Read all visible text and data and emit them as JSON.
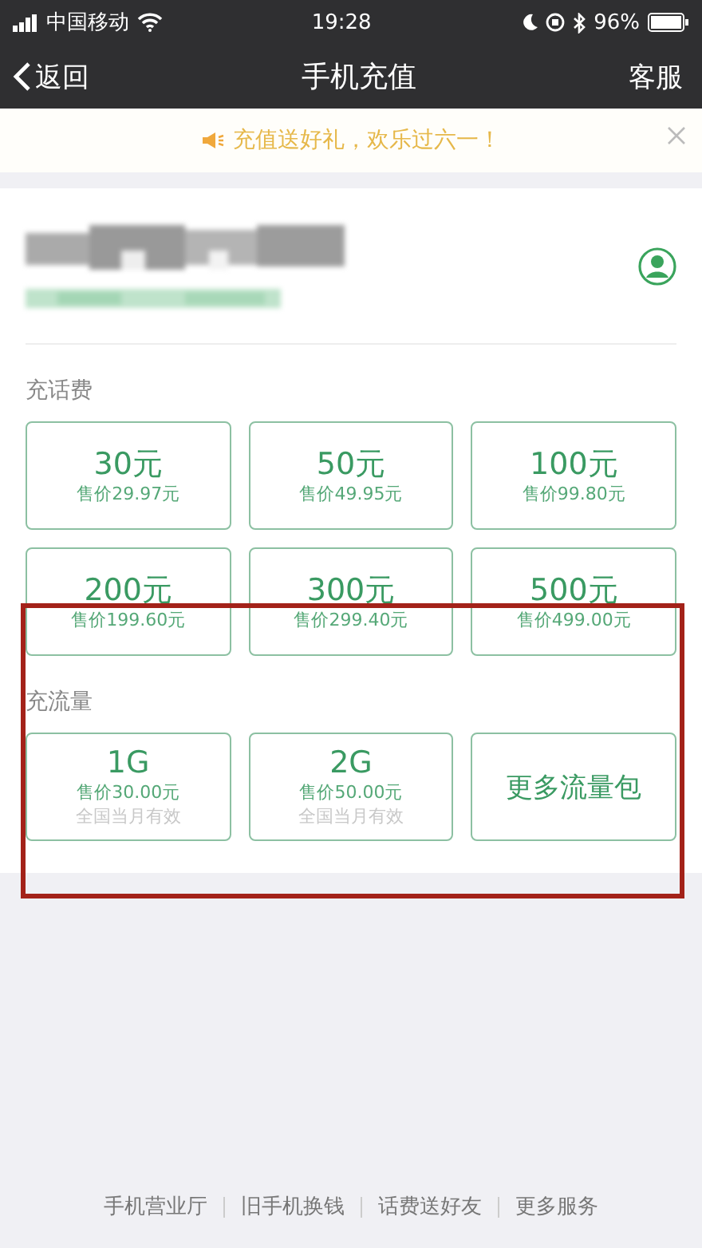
{
  "status_bar": {
    "carrier": "中国移动",
    "time": "19:28",
    "battery": "96%"
  },
  "nav": {
    "back": "返回",
    "title": "手机充值",
    "action": "客服"
  },
  "notice": {
    "text": "充值送好礼，欢乐过六一！"
  },
  "sections": [
    {
      "label": "充话费",
      "highlighted": false,
      "tiles": [
        {
          "kind": "price",
          "amount": "30元",
          "price": "售价29.97元"
        },
        {
          "kind": "price",
          "amount": "50元",
          "price": "售价49.95元"
        },
        {
          "kind": "price",
          "amount": "100元",
          "price": "售价99.80元"
        },
        {
          "kind": "price",
          "amount": "200元",
          "price": "售价199.60元"
        },
        {
          "kind": "price",
          "amount": "300元",
          "price": "售价299.40元"
        },
        {
          "kind": "price",
          "amount": "500元",
          "price": "售价499.00元"
        }
      ]
    },
    {
      "label": "充流量",
      "highlighted": true,
      "tiles": [
        {
          "kind": "price",
          "amount": "1G",
          "price": "售价30.00元",
          "note": "全国当月有效"
        },
        {
          "kind": "price",
          "amount": "2G",
          "price": "售价50.00元",
          "note": "全国当月有效"
        },
        {
          "kind": "more",
          "label": "更多流量包"
        }
      ]
    }
  ],
  "footer_links": [
    "手机营业厅",
    "旧手机换钱",
    "话费送好友",
    "更多服务"
  ]
}
